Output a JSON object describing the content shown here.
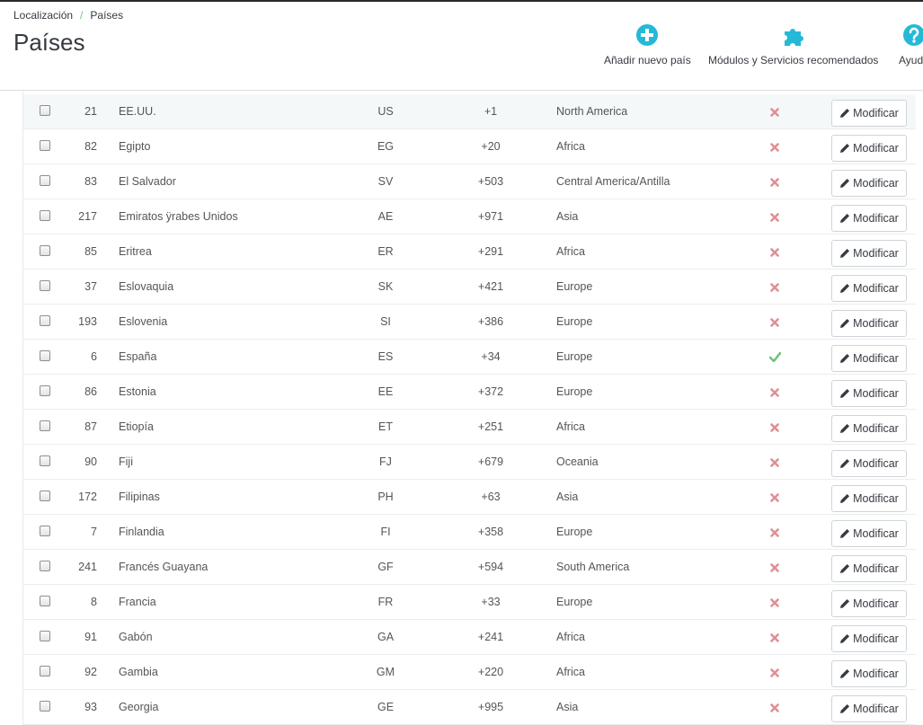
{
  "breadcrumb": {
    "parent": "Localización",
    "separator": "/",
    "current": "Países"
  },
  "page_title": "Países",
  "toolbar": {
    "add_label": "Añadir nuevo país",
    "modules_label": "Módulos y Servicios recomendados",
    "help_label": "Ayuda"
  },
  "colors": {
    "accent": "#25b9d7",
    "enabled": "#72c279",
    "disabled": "#e08f95"
  },
  "table": {
    "edit_label": "Modificar",
    "rows": [
      {
        "id": "21",
        "name": "EE.UU.",
        "iso": "US",
        "code": "+1",
        "zone": "North America",
        "enabled": false
      },
      {
        "id": "82",
        "name": "Egipto",
        "iso": "EG",
        "code": "+20",
        "zone": "Africa",
        "enabled": false
      },
      {
        "id": "83",
        "name": "El Salvador",
        "iso": "SV",
        "code": "+503",
        "zone": "Central America/Antilla",
        "enabled": false
      },
      {
        "id": "217",
        "name": "Emiratos ÿrabes Unidos",
        "iso": "AE",
        "code": "+971",
        "zone": "Asia",
        "enabled": false
      },
      {
        "id": "85",
        "name": "Eritrea",
        "iso": "ER",
        "code": "+291",
        "zone": "Africa",
        "enabled": false
      },
      {
        "id": "37",
        "name": "Eslovaquia",
        "iso": "SK",
        "code": "+421",
        "zone": "Europe",
        "enabled": false
      },
      {
        "id": "193",
        "name": "Eslovenia",
        "iso": "SI",
        "code": "+386",
        "zone": "Europe",
        "enabled": false
      },
      {
        "id": "6",
        "name": "España",
        "iso": "ES",
        "code": "+34",
        "zone": "Europe",
        "enabled": true
      },
      {
        "id": "86",
        "name": "Estonia",
        "iso": "EE",
        "code": "+372",
        "zone": "Europe",
        "enabled": false
      },
      {
        "id": "87",
        "name": "Etiopía",
        "iso": "ET",
        "code": "+251",
        "zone": "Africa",
        "enabled": false
      },
      {
        "id": "90",
        "name": "Fiji",
        "iso": "FJ",
        "code": "+679",
        "zone": "Oceania",
        "enabled": false
      },
      {
        "id": "172",
        "name": "Filipinas",
        "iso": "PH",
        "code": "+63",
        "zone": "Asia",
        "enabled": false
      },
      {
        "id": "7",
        "name": "Finlandia",
        "iso": "FI",
        "code": "+358",
        "zone": "Europe",
        "enabled": false
      },
      {
        "id": "241",
        "name": "Francés Guayana",
        "iso": "GF",
        "code": "+594",
        "zone": "South America",
        "enabled": false
      },
      {
        "id": "8",
        "name": "Francia",
        "iso": "FR",
        "code": "+33",
        "zone": "Europe",
        "enabled": false
      },
      {
        "id": "91",
        "name": "Gabón",
        "iso": "GA",
        "code": "+241",
        "zone": "Africa",
        "enabled": false
      },
      {
        "id": "92",
        "name": "Gambia",
        "iso": "GM",
        "code": "+220",
        "zone": "Africa",
        "enabled": false
      },
      {
        "id": "93",
        "name": "Georgia",
        "iso": "GE",
        "code": "+995",
        "zone": "Asia",
        "enabled": false
      },
      {
        "id": "",
        "name": "",
        "iso": "",
        "code": "",
        "zone": "",
        "enabled": false
      }
    ]
  }
}
